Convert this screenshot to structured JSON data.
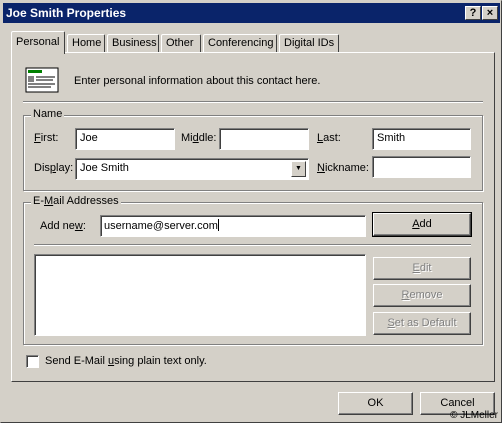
{
  "window": {
    "title": "Joe Smith Properties",
    "help_btn": "?",
    "close_btn": "×"
  },
  "tabs": [
    "Personal",
    "Home",
    "Business",
    "Other",
    "Conferencing",
    "Digital IDs"
  ],
  "intro": {
    "text": "Enter personal information about this contact here.",
    "icon": "contact-card-icon"
  },
  "name_group": {
    "legend": "Name",
    "first_label": "First:",
    "first_value": "Joe",
    "middle_label": "Middle:",
    "middle_value": "",
    "last_label": "Last:",
    "last_value": "Smith",
    "display_label": "Display:",
    "display_value": "Joe Smith",
    "nickname_label": "Nickname:",
    "nickname_value": ""
  },
  "email_group": {
    "legend": "E-Mail Addresses",
    "add_new_label": "Add new:",
    "add_new_value": "username@server.com",
    "add_button": "Add",
    "edit_button": "Edit",
    "remove_button": "Remove",
    "set_default_button": "Set as Default",
    "addresses": []
  },
  "plain_text_checkbox": {
    "label": "Send E-Mail using plain text only.",
    "checked": false
  },
  "footer": {
    "ok": "OK",
    "cancel": "Cancel",
    "copyright": "© JLMeller"
  }
}
